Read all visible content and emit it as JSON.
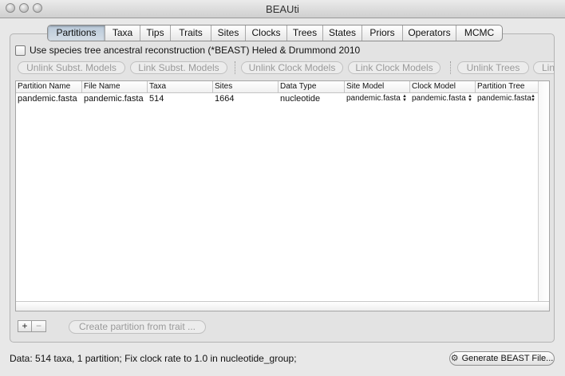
{
  "window": {
    "title": "BEAUti"
  },
  "tabs": [
    {
      "label": "Partitions",
      "active": true
    },
    {
      "label": "Taxa",
      "active": false
    },
    {
      "label": "Tips",
      "active": false
    },
    {
      "label": "Traits",
      "active": false
    },
    {
      "label": "Sites",
      "active": false
    },
    {
      "label": "Clocks",
      "active": false
    },
    {
      "label": "Trees",
      "active": false
    },
    {
      "label": "States",
      "active": false
    },
    {
      "label": "Priors",
      "active": false
    },
    {
      "label": "Operators",
      "active": false
    },
    {
      "label": "MCMC",
      "active": false
    }
  ],
  "species_option": {
    "label": "Use species tree ancestral reconstruction (*BEAST) Heled & Drummond 2010",
    "checked": false
  },
  "toolbar": {
    "unlink_subst": "Unlink Subst. Models",
    "link_subst": "Link Subst. Models",
    "unlink_clock": "Unlink Clock Models",
    "link_clock": "Link Clock Models",
    "unlink_trees": "Unlink Trees",
    "link_trees": "Link Trees"
  },
  "table": {
    "columns": [
      "Partition Name",
      "File Name",
      "Taxa",
      "Sites",
      "Data Type",
      "Site Model",
      "Clock Model",
      "Partition Tree"
    ],
    "rows": [
      {
        "partition_name": "pandemic.fasta",
        "file_name": "pandemic.fasta",
        "taxa": "514",
        "sites": "1664",
        "data_type": "nucleotide",
        "site_model": "pandemic.fasta",
        "clock_model": "pandemic.fasta",
        "partition_tree": "pandemic.fasta"
      }
    ]
  },
  "controls": {
    "add_label": "+",
    "remove_label": "−",
    "create_partition_label": "Create partition from trait ..."
  },
  "status_text": "Data: 514 taxa, 1 partition; Fix clock rate to 1.0 in nucleotide_group;",
  "generate_button": {
    "label": "Generate BEAST File...",
    "icon": "gear-icon"
  }
}
